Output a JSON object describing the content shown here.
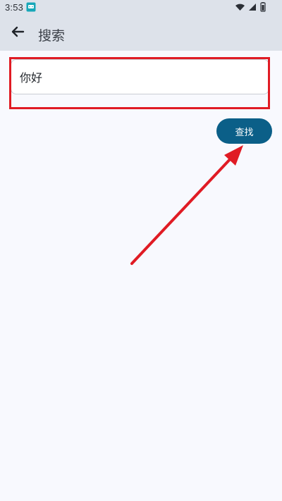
{
  "status_bar": {
    "time": "3:53",
    "icons": {
      "app": "notification-app-icon",
      "wifi": "wifi-icon",
      "signal": "cell-signal-icon",
      "battery": "battery-icon"
    }
  },
  "app_bar": {
    "title": "搜索",
    "back_icon": "arrow-left-icon"
  },
  "search": {
    "value": "你好",
    "placeholder": ""
  },
  "actions": {
    "find_label": "查找"
  },
  "colors": {
    "topbar_bg": "#dde2ea",
    "page_bg": "#f8f9fe",
    "primary": "#0b5f88",
    "highlight": "#e01b24"
  }
}
